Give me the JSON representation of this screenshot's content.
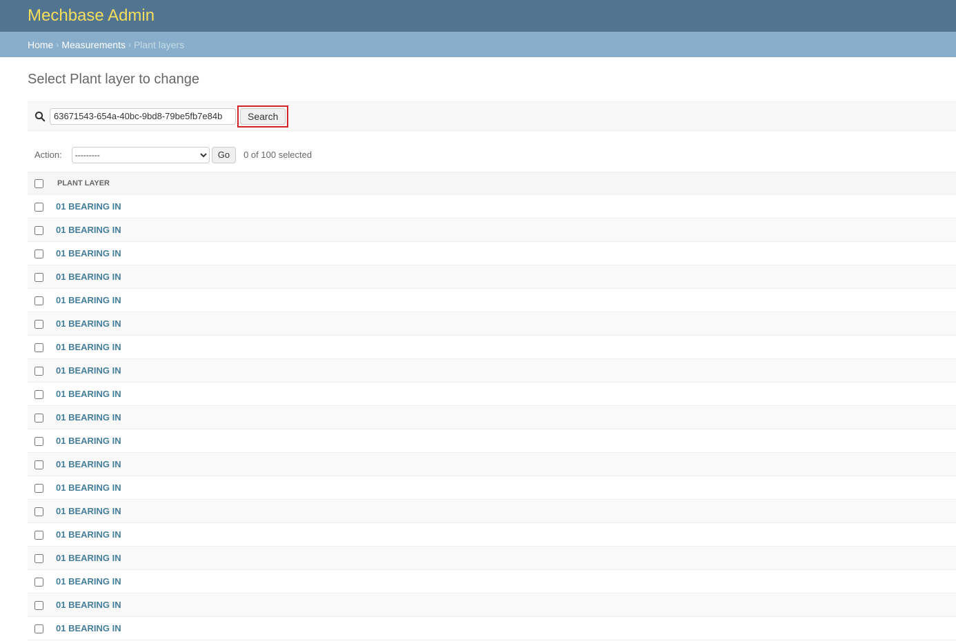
{
  "header": {
    "branding": "Mechbase Admin"
  },
  "breadcrumbs": {
    "home": "Home",
    "measurements": "Measurements",
    "current": "Plant layers",
    "separator": "›"
  },
  "page": {
    "title": "Select Plant layer to change"
  },
  "search": {
    "value": "63671543-654a-40bc-9bd8-79be5fb7e84b",
    "button_label": "Search",
    "icon": "search-icon"
  },
  "actions": {
    "label": "Action:",
    "selected_option": "---------",
    "go_label": "Go",
    "selected_count": "0 of 100 selected"
  },
  "table": {
    "column_header": "PLANT LAYER",
    "rows": [
      "01 BEARING IN",
      "01 BEARING IN",
      "01 BEARING IN",
      "01 BEARING IN",
      "01 BEARING IN",
      "01 BEARING IN",
      "01 BEARING IN",
      "01 BEARING IN",
      "01 BEARING IN",
      "01 BEARING IN",
      "01 BEARING IN",
      "01 BEARING IN",
      "01 BEARING IN",
      "01 BEARING IN",
      "01 BEARING IN",
      "01 BEARING IN",
      "01 BEARING IN",
      "01 BEARING IN",
      "01 BEARING IN"
    ]
  },
  "colors": {
    "header_bg": "#517591",
    "branding": "#f5dd5d",
    "breadcrumb_bg": "#88aecb",
    "link": "#447e9b",
    "highlight_border": "#d1232a"
  }
}
